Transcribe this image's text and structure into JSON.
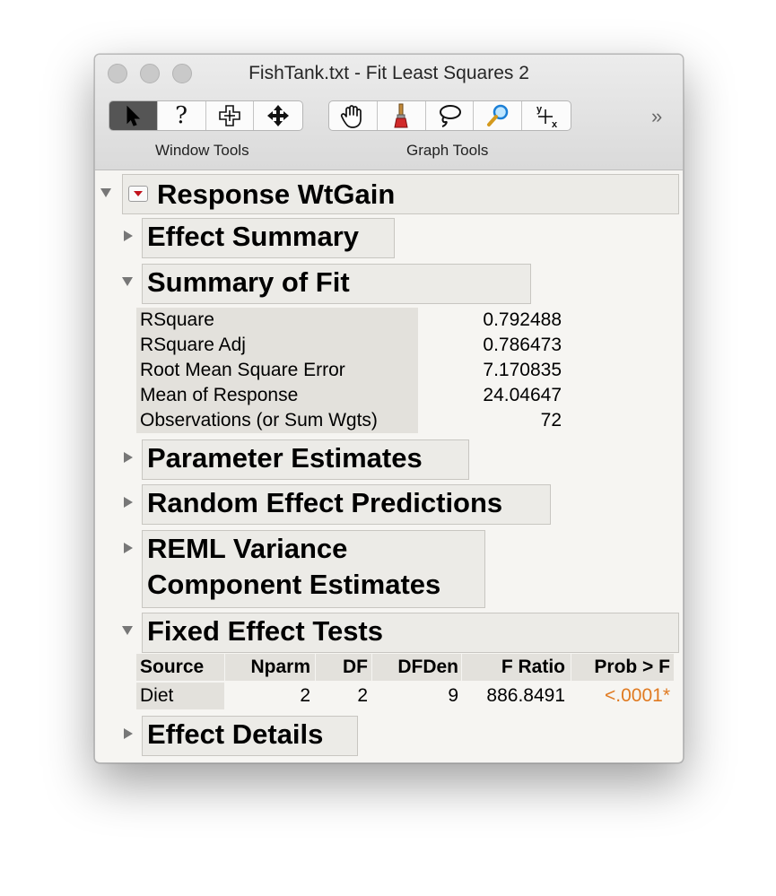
{
  "window": {
    "title": "FishTank.txt - Fit Least Squares 2",
    "window_tools_label": "Window Tools",
    "graph_tools_label": "Graph Tools",
    "help_glyph": "?",
    "overflow_glyph": "»"
  },
  "report": {
    "response_title": "Response WtGain",
    "effect_summary": "Effect Summary",
    "summary_of_fit": {
      "title": "Summary of Fit",
      "rows": [
        {
          "label": "RSquare",
          "value": "0.792488"
        },
        {
          "label": "RSquare Adj",
          "value": "0.786473"
        },
        {
          "label": "Root Mean Square Error",
          "value": "7.170835"
        },
        {
          "label": "Mean of Response",
          "value": "24.04647"
        },
        {
          "label": "Observations (or Sum Wgts)",
          "value": "72"
        }
      ]
    },
    "parameter_estimates": "Parameter Estimates",
    "random_effect_predictions": "Random Effect Predictions",
    "reml_line1": "REML Variance",
    "reml_line2": "Component Estimates",
    "fixed_effect_tests": {
      "title": "Fixed Effect Tests",
      "headers": [
        "Source",
        "Nparm",
        "DF",
        "DFDen",
        "F Ratio",
        "Prob > F"
      ],
      "row": {
        "source": "Diet",
        "nparm": "2",
        "df": "2",
        "dfden": "9",
        "f_ratio": "886.8491",
        "prob": "<.0001*"
      }
    },
    "effect_details": "Effect Details"
  },
  "colors": {
    "significant": "#e07a21",
    "red_triangle": "#c1121c",
    "selected_tool": "#555555"
  },
  "icons": [
    "arrow-icon",
    "help-icon",
    "crosshair-icon",
    "move-icon",
    "hand-icon",
    "brush-icon",
    "lasso-icon",
    "magnifier-icon",
    "scaler-icon"
  ]
}
